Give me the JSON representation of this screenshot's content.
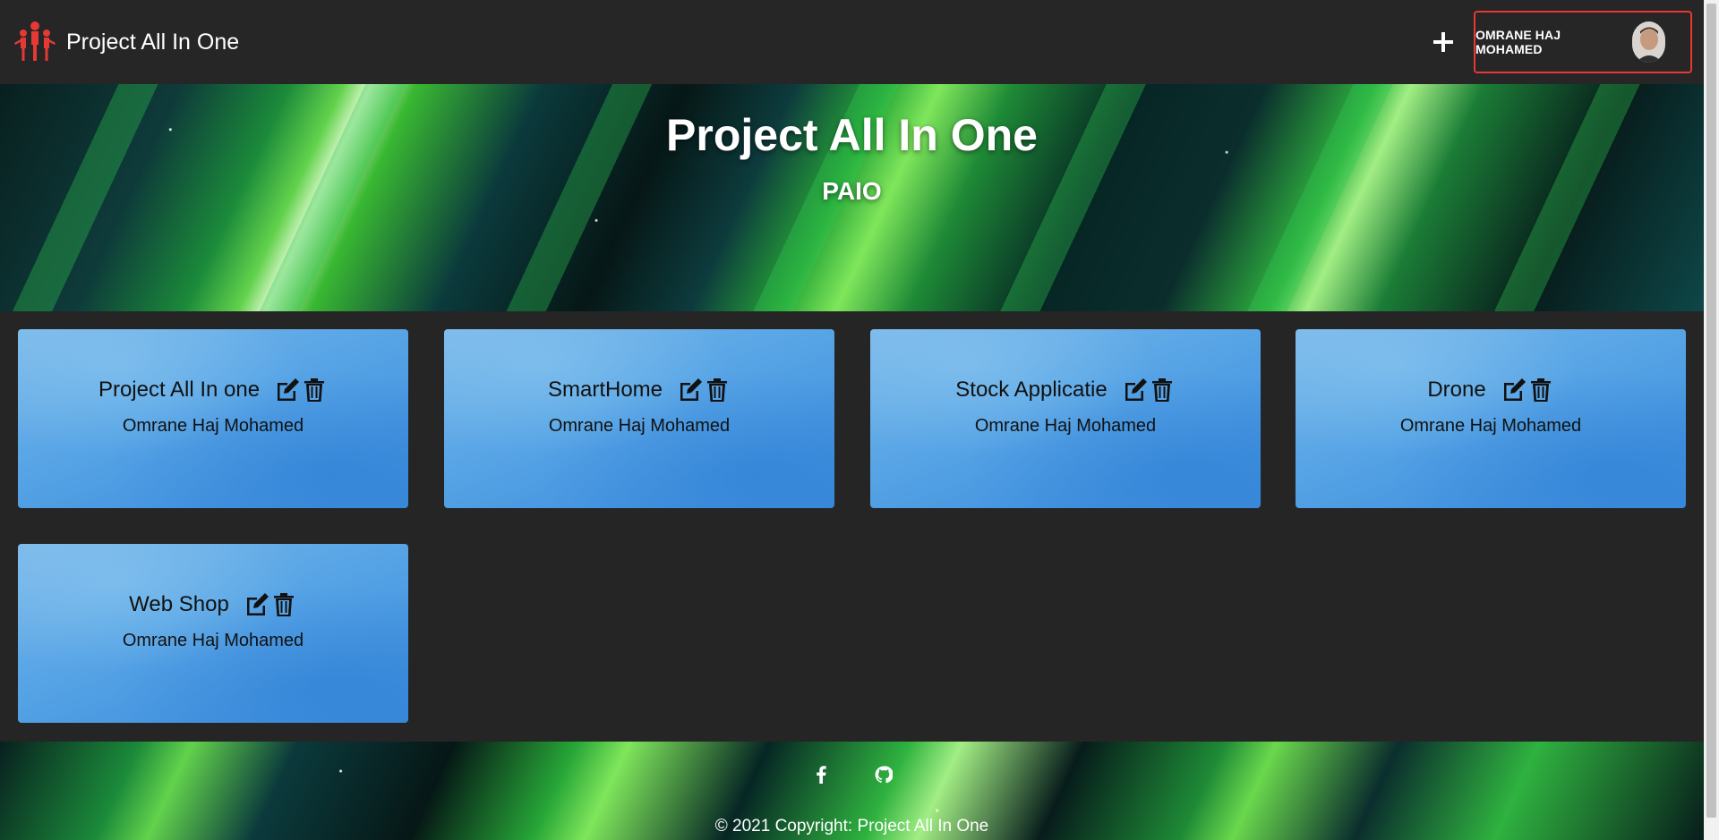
{
  "navbar": {
    "brand": "Project All In One",
    "logo_icon": "people-group-icon",
    "add_icon": "plus-icon",
    "user_name": "OMRANE HAJ MOHAMED",
    "accent": "#e53935"
  },
  "hero": {
    "title": "Project All In One",
    "subtitle": "PAIO"
  },
  "projects": [
    {
      "title": "Project All In one",
      "owner": "Omrane Haj Mohamed"
    },
    {
      "title": "SmartHome",
      "owner": "Omrane Haj Mohamed"
    },
    {
      "title": "Stock Applicatie",
      "owner": "Omrane Haj Mohamed"
    },
    {
      "title": "Drone",
      "owner": "Omrane Haj Mohamed"
    },
    {
      "title": "Web Shop",
      "owner": "Omrane Haj Mohamed"
    }
  ],
  "footer": {
    "social": [
      "facebook-icon",
      "github-icon"
    ],
    "copyright": "© 2021 Copyright: Project All In One"
  }
}
